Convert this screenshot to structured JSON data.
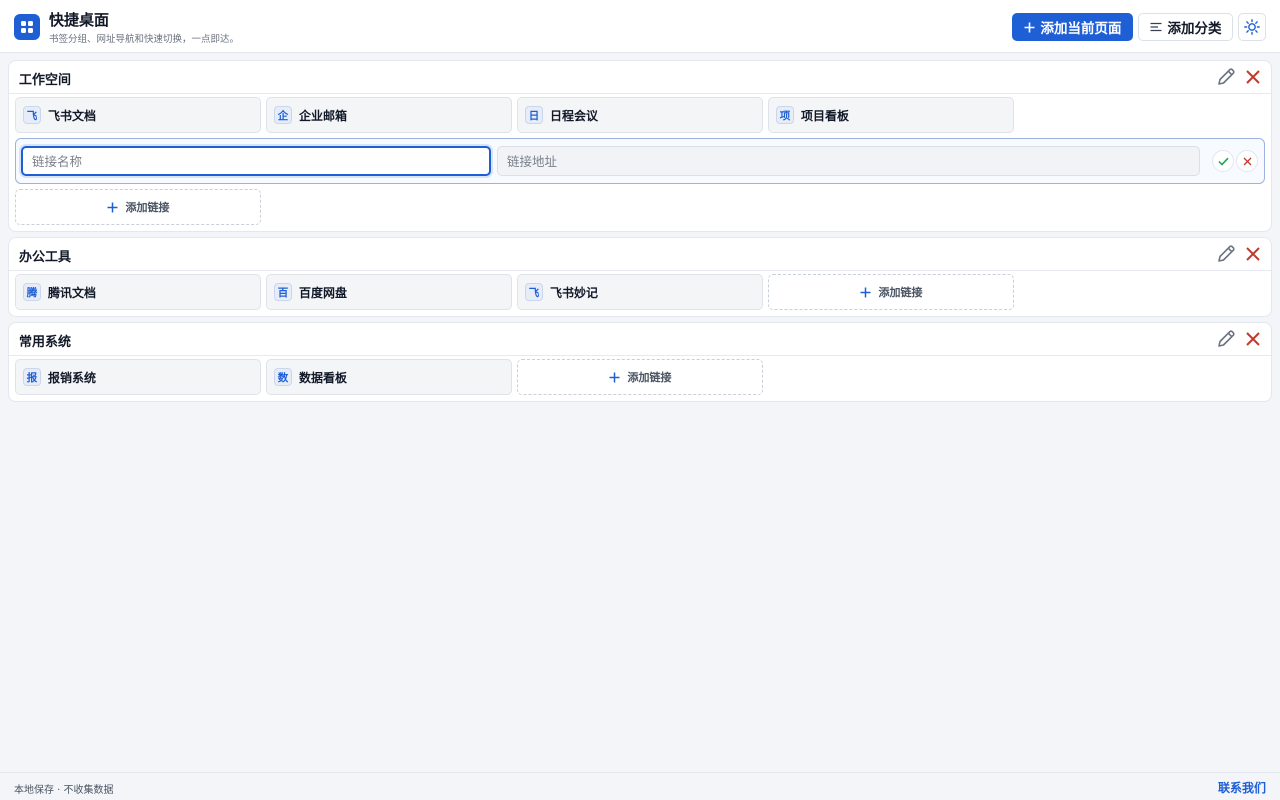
{
  "header": {
    "app_name": "快捷桌面",
    "subtitle": "书签分组、网址导航和快速切换，一点即达。",
    "add_current_page_label": "添加当前页面",
    "add_category_label": "添加分类",
    "accent_color": "#1f5fd6"
  },
  "groups": [
    {
      "title": "工作空间",
      "links": [
        {
          "badge": "飞",
          "name": "飞书文档"
        },
        {
          "badge": "企",
          "name": "企业邮箱"
        },
        {
          "badge": "日",
          "name": "日程会议"
        },
        {
          "badge": "项",
          "name": "项目看板"
        }
      ],
      "new_link_form": {
        "name_placeholder": "链接名称",
        "url_placeholder": "链接地址"
      },
      "add_link_label": "添加链接"
    },
    {
      "title": "办公工具",
      "links": [
        {
          "badge": "腾",
          "name": "腾讯文档"
        },
        {
          "badge": "百",
          "name": "百度网盘"
        },
        {
          "badge": "飞",
          "name": "飞书妙记"
        }
      ],
      "add_link_label": "添加链接"
    },
    {
      "title": "常用系统",
      "links": [
        {
          "badge": "报",
          "name": "报销系统"
        },
        {
          "badge": "数",
          "name": "数据看板"
        }
      ],
      "add_link_label": "添加链接"
    }
  ],
  "icons": {
    "edit": "pencil-icon",
    "delete": "close-icon",
    "confirm": "check-icon",
    "cancel": "close-icon",
    "add": "plus-icon",
    "category": "list-icon",
    "theme": "sun-icon"
  },
  "footer": {
    "privacy_note": "本地保存 · 不收集数据",
    "contact_label": "联系我们"
  }
}
